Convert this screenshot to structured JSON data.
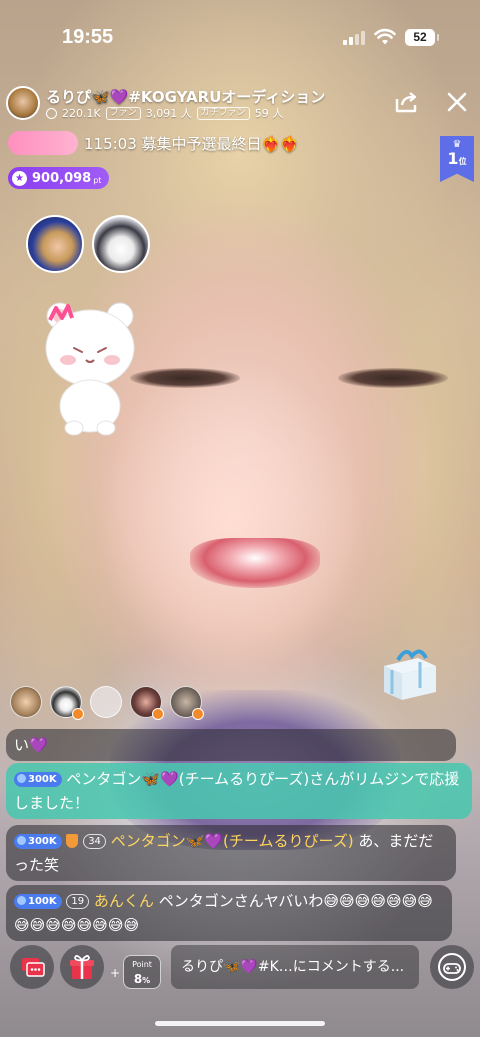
{
  "status_bar": {
    "time": "19:55",
    "battery": "52"
  },
  "header": {
    "title": "るりぴ🦋💜#KOGYARUオーディション",
    "followers": "220.1K",
    "fan_label": "ファン",
    "fan_count": "3,091 人",
    "gachi_label": "ガチファン",
    "gachi_count": "59 人"
  },
  "event": {
    "countdown_text": "115:03 募集中予選最終日❤️‍🔥❤️‍🔥"
  },
  "ranking": {
    "crown": "♛",
    "rank": "1",
    "suffix": "位"
  },
  "points": {
    "value": "900,098",
    "unit": "pt",
    "star": "★"
  },
  "chat": [
    {
      "text": "い💜"
    },
    {
      "badge": "300K",
      "user": "ペンタゴン🦋💜(チームるりぴーズ)さんがリムジンで応援しました！"
    },
    {
      "badge": "300K",
      "rank": "34",
      "user": "ペンタゴン🦋💜(チームるりぴーズ)",
      "text": " あ、まだだった笑"
    },
    {
      "badge": "100K",
      "rank": "19",
      "user": "あんくん",
      "text": " ペンタゴンさんヤバいわ😅😅😅😅😅😅😅😅😅😅😅😅😅😅😅"
    }
  ],
  "bottom": {
    "plus": "+",
    "point_label": "Point",
    "point_value": "8",
    "point_unit": "%",
    "comment_placeholder": "るりぴ🦋💜#K…にコメントする..."
  },
  "colors": {
    "points_pill": "#8a3df0",
    "rank_badge": "#5d6ee8",
    "highlight_msg": "#46c8af",
    "level_badge": "#4a7cf0"
  },
  "icons": [
    "share-icon",
    "close-icon",
    "chat-icon",
    "gift-icon",
    "gamepad-icon",
    "crown-icon",
    "star-icon",
    "wifi-icon",
    "signal-icon",
    "battery-icon"
  ]
}
